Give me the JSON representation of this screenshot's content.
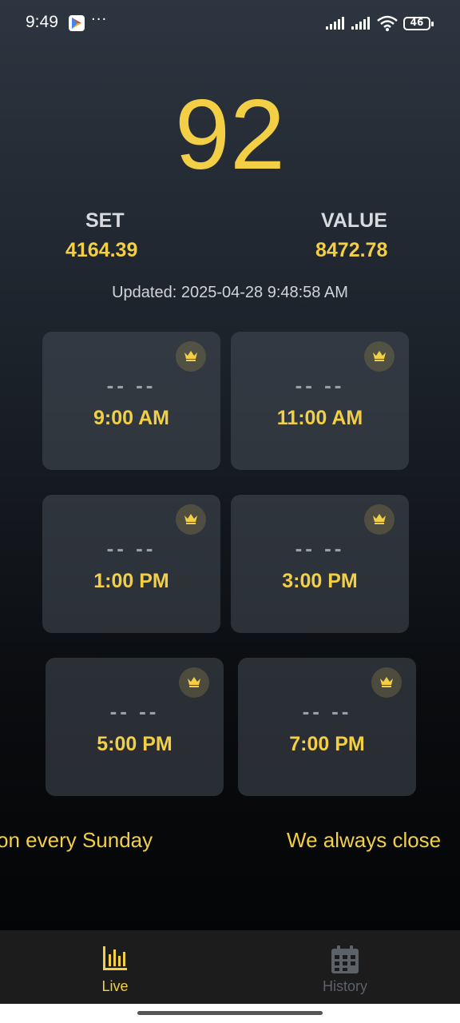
{
  "status_bar": {
    "time": "9:49",
    "more_glyph": "···",
    "battery": "46",
    "icons": [
      "play-store-icon",
      "signal-icon",
      "signal-icon",
      "wifi-icon",
      "battery-icon"
    ]
  },
  "main": {
    "big_number": "92",
    "set_label": "SET",
    "set_value": "4164.39",
    "value_label": "VALUE",
    "value_value": "8472.78",
    "updated": "Updated: 2025-04-28 9:48:58 AM"
  },
  "cards": [
    {
      "result": "-- --",
      "time": "9:00 AM",
      "icon": "crown-icon"
    },
    {
      "result": "-- --",
      "time": "11:00 AM",
      "icon": "crown-icon"
    },
    {
      "result": "-- --",
      "time": "1:00 PM",
      "icon": "crown-icon"
    },
    {
      "result": "-- --",
      "time": "3:00 PM",
      "icon": "crown-icon"
    },
    {
      "result": "-- --",
      "time": "5:00 PM",
      "icon": "crown-icon"
    },
    {
      "result": "-- --",
      "time": "7:00 PM",
      "icon": "crown-icon"
    }
  ],
  "marquee": {
    "left": "on every Sunday",
    "right": "We always close"
  },
  "nav": {
    "live": "Live",
    "history": "History"
  },
  "colors": {
    "accent": "#f2cf45",
    "inactive": "#5d6168",
    "nav_bg": "#1c1c1c"
  }
}
